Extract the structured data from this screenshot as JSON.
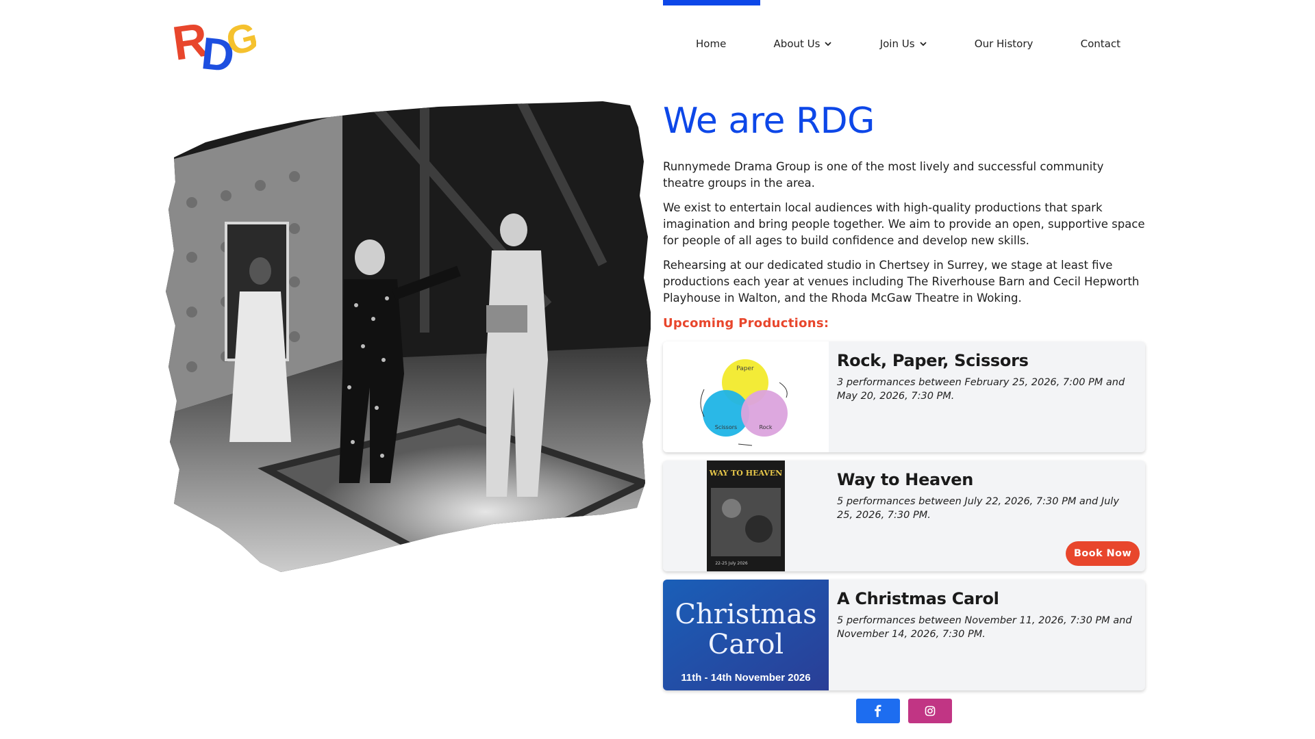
{
  "logo": {
    "text": "RDG"
  },
  "nav": {
    "items": [
      {
        "label": "Home",
        "dropdown": false
      },
      {
        "label": "About Us",
        "dropdown": true
      },
      {
        "label": "Join Us",
        "dropdown": true
      },
      {
        "label": "Our History",
        "dropdown": false
      },
      {
        "label": "Contact",
        "dropdown": false
      }
    ]
  },
  "main": {
    "headline": "We are RDG",
    "paragraphs": [
      "Runnymede Drama Group is one of the most lively and successful community theatre groups in the area.",
      "We exist to entertain local audiences with high-quality productions that spark imagination and bring people together. We aim to provide an open, supportive space for people of all ages to build confidence and develop new skills.",
      "Rehearsing at our dedicated studio in Chertsey in Surrey, we stage at least five productions each year at venues including The Riverhouse Barn and Cecil Hepworth Playhouse in Walton, and the Rhoda McGaw Theatre in Woking."
    ],
    "upcoming_label": "Upcoming Productions:"
  },
  "productions": [
    {
      "title": "Rock, Paper, Scissors",
      "description": "3 performances between February 25, 2026, 7:00 PM and May 20, 2026, 7:30 PM.",
      "poster_labels": [
        "Paper",
        "Scissors",
        "Rock"
      ]
    },
    {
      "title": "Way to Heaven",
      "description": "5 performances between July 22, 2026, 7:30 PM and July 25, 2026, 7:30 PM.",
      "poster_title": "WAY TO HEAVEN",
      "poster_dates": "22-25 July 2026",
      "book_label": "Book Now"
    },
    {
      "title": "A Christmas Carol",
      "description": "5 performances between November 11, 2026, 7:30 PM and November 14, 2026, 7:30 PM.",
      "poster_line1": "Christmas",
      "poster_line2": "Carol",
      "poster_dates": "11th - 14th November 2026"
    }
  ],
  "social": {
    "facebook_icon": "facebook-icon",
    "instagram_icon": "instagram-icon"
  },
  "colors": {
    "brand_blue": "#0d47e8",
    "accent_red": "#e8462c",
    "facebook": "#1d6df0",
    "instagram": "#c13584"
  }
}
